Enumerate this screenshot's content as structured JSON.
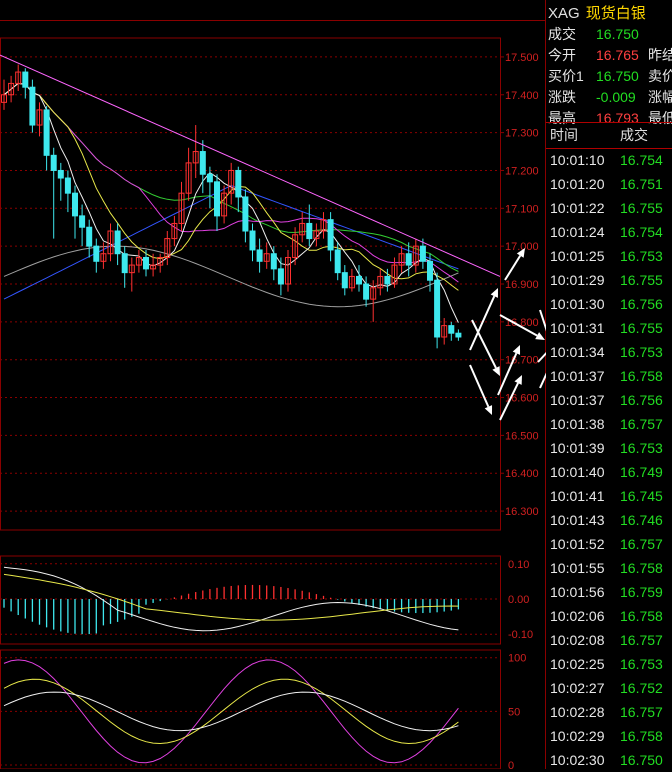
{
  "header": {
    "code": "XAG",
    "name": "现货白银"
  },
  "quote": [
    {
      "label": "成交",
      "value": "16.750",
      "color": "#22dd22",
      "right": ""
    },
    {
      "label": "今开",
      "value": "16.765",
      "color": "#ff4040",
      "right": "昨结"
    },
    {
      "label": "买价1",
      "value": "16.750",
      "color": "#22dd22",
      "right": "卖价"
    },
    {
      "label": "涨跌",
      "value": "-0.009",
      "color": "#22dd22",
      "right": "涨幅"
    },
    {
      "label": "最高",
      "value": "16.793",
      "color": "#ff4040",
      "right": "最低"
    }
  ],
  "tick_headers": {
    "time": "时间",
    "price": "成交"
  },
  "ticks": [
    {
      "time": "10:01:10",
      "price": "16.754"
    },
    {
      "time": "10:01:20",
      "price": "16.751"
    },
    {
      "time": "10:01:22",
      "price": "16.755"
    },
    {
      "time": "10:01:24",
      "price": "16.754"
    },
    {
      "time": "10:01:25",
      "price": "16.753"
    },
    {
      "time": "10:01:29",
      "price": "16.755"
    },
    {
      "time": "10:01:30",
      "price": "16.756"
    },
    {
      "time": "10:01:31",
      "price": "16.755"
    },
    {
      "time": "10:01:34",
      "price": "16.753"
    },
    {
      "time": "10:01:37",
      "price": "16.758"
    },
    {
      "time": "10:01:37",
      "price": "16.756"
    },
    {
      "time": "10:01:38",
      "price": "16.757"
    },
    {
      "time": "10:01:39",
      "price": "16.753"
    },
    {
      "time": "10:01:40",
      "price": "16.749"
    },
    {
      "time": "10:01:41",
      "price": "16.745"
    },
    {
      "time": "10:01:43",
      "price": "16.746"
    },
    {
      "time": "10:01:52",
      "price": "16.757"
    },
    {
      "time": "10:01:55",
      "price": "16.758"
    },
    {
      "time": "10:01:56",
      "price": "16.759"
    },
    {
      "time": "10:02:06",
      "price": "16.758"
    },
    {
      "time": "10:02:08",
      "price": "16.757"
    },
    {
      "time": "10:02:25",
      "price": "16.753"
    },
    {
      "time": "10:02:27",
      "price": "16.752"
    },
    {
      "time": "10:02:28",
      "price": "16.757"
    },
    {
      "time": "10:02:29",
      "price": "16.758"
    },
    {
      "time": "10:02:30",
      "price": "16.750"
    }
  ],
  "colors": {
    "up": "#ff3030",
    "down": "#3ee8ee",
    "grid": "#8a0000",
    "ma5": "#f0f0f0",
    "ma10": "#e8e84a",
    "ma20": "#e040e0",
    "ma30": "#33cc33",
    "ma60": "#3355ff",
    "ma120": "#a0a0a0",
    "trend": "#ff66ff"
  },
  "chart_data": [
    {
      "type": "candlestick",
      "ylim": [
        16.25,
        17.55
      ],
      "yticks": [
        "17.500",
        "17.400",
        "17.300",
        "17.200",
        "17.100",
        "17.000",
        "16.900",
        "16.800",
        "16.700",
        "16.600",
        "16.500",
        "16.400",
        "16.300"
      ],
      "candles": [
        [
          17.38,
          17.4,
          17.36,
          17.44
        ],
        [
          17.4,
          17.43,
          17.38,
          17.45
        ],
        [
          17.43,
          17.46,
          17.41,
          17.48
        ],
        [
          17.46,
          17.42,
          17.39,
          17.47
        ],
        [
          17.42,
          17.32,
          17.3,
          17.44
        ],
        [
          17.32,
          17.36,
          17.29,
          17.38
        ],
        [
          17.36,
          17.24,
          17.2,
          17.37
        ],
        [
          17.24,
          17.2,
          17.02,
          17.26
        ],
        [
          17.2,
          17.18,
          17.12,
          17.22
        ],
        [
          17.18,
          17.14,
          17.09,
          17.2
        ],
        [
          17.14,
          17.08,
          17.02,
          17.16
        ],
        [
          17.08,
          17.05,
          17.0,
          17.11
        ],
        [
          17.05,
          17.0,
          16.97,
          17.07
        ],
        [
          17.0,
          16.96,
          16.93,
          17.02
        ],
        [
          16.96,
          16.98,
          16.94,
          17.01
        ],
        [
          16.98,
          17.04,
          16.96,
          17.06
        ],
        [
          17.04,
          16.98,
          16.95,
          17.06
        ],
        [
          16.98,
          16.93,
          16.89,
          17.0
        ],
        [
          16.93,
          16.95,
          16.88,
          16.97
        ],
        [
          16.95,
          16.97,
          16.93,
          16.99
        ],
        [
          16.97,
          16.94,
          16.92,
          16.99
        ],
        [
          16.94,
          16.95,
          16.92,
          16.98
        ],
        [
          16.95,
          16.97,
          16.93,
          16.98
        ],
        [
          16.97,
          17.02,
          16.95,
          17.04
        ],
        [
          17.02,
          17.06,
          17.0,
          17.08
        ],
        [
          17.06,
          17.14,
          17.04,
          17.17
        ],
        [
          17.14,
          17.22,
          17.12,
          17.26
        ],
        [
          17.22,
          17.25,
          17.18,
          17.32
        ],
        [
          17.25,
          17.19,
          17.14,
          17.28
        ],
        [
          17.19,
          17.17,
          17.1,
          17.21
        ],
        [
          17.17,
          17.08,
          17.04,
          17.19
        ],
        [
          17.08,
          17.14,
          17.06,
          17.16
        ],
        [
          17.14,
          17.2,
          17.11,
          17.22
        ],
        [
          17.2,
          17.13,
          17.09,
          17.21
        ],
        [
          17.13,
          17.04,
          17.01,
          17.15
        ],
        [
          17.04,
          16.99,
          16.96,
          17.06
        ],
        [
          16.99,
          16.96,
          16.93,
          17.02
        ],
        [
          16.96,
          16.98,
          16.94,
          17.01
        ],
        [
          16.98,
          16.94,
          16.91,
          17.0
        ],
        [
          16.94,
          16.9,
          16.87,
          16.97
        ],
        [
          16.9,
          16.97,
          16.88,
          16.99
        ],
        [
          16.97,
          17.03,
          16.95,
          17.05
        ],
        [
          17.03,
          17.06,
          17.01,
          17.09
        ],
        [
          17.06,
          17.02,
          17.0,
          17.11
        ],
        [
          17.02,
          17.04,
          17.0,
          17.06
        ],
        [
          17.04,
          17.07,
          17.02,
          17.09
        ],
        [
          17.07,
          16.99,
          16.96,
          17.09
        ],
        [
          16.99,
          16.93,
          16.91,
          17.01
        ],
        [
          16.93,
          16.89,
          16.87,
          16.95
        ],
        [
          16.89,
          16.92,
          16.88,
          16.94
        ],
        [
          16.92,
          16.9,
          16.88,
          16.95
        ],
        [
          16.9,
          16.86,
          16.84,
          16.92
        ],
        [
          16.86,
          16.89,
          16.8,
          16.91
        ],
        [
          16.89,
          16.92,
          16.87,
          16.94
        ],
        [
          16.92,
          16.9,
          16.88,
          16.94
        ],
        [
          16.9,
          16.95,
          16.89,
          16.97
        ],
        [
          16.95,
          16.98,
          16.93,
          17.0
        ],
        [
          16.98,
          16.95,
          16.92,
          17.01
        ],
        [
          16.95,
          17.0,
          16.93,
          17.02
        ],
        [
          17.0,
          16.96,
          16.94,
          17.02
        ],
        [
          16.96,
          16.91,
          16.88,
          16.98
        ],
        [
          16.91,
          16.76,
          16.73,
          16.93
        ],
        [
          16.76,
          16.79,
          16.74,
          16.81
        ],
        [
          16.79,
          16.77,
          16.75,
          16.8
        ],
        [
          16.77,
          16.76,
          16.75,
          16.78
        ]
      ]
    },
    {
      "type": "bar",
      "yticks": [
        "0.10",
        "0.00",
        "-0.10"
      ],
      "ylim": [
        -0.125,
        0.125
      ]
    },
    {
      "type": "line",
      "yticks": [
        "100",
        "50",
        "0"
      ],
      "ylim": [
        0,
        110
      ]
    }
  ]
}
